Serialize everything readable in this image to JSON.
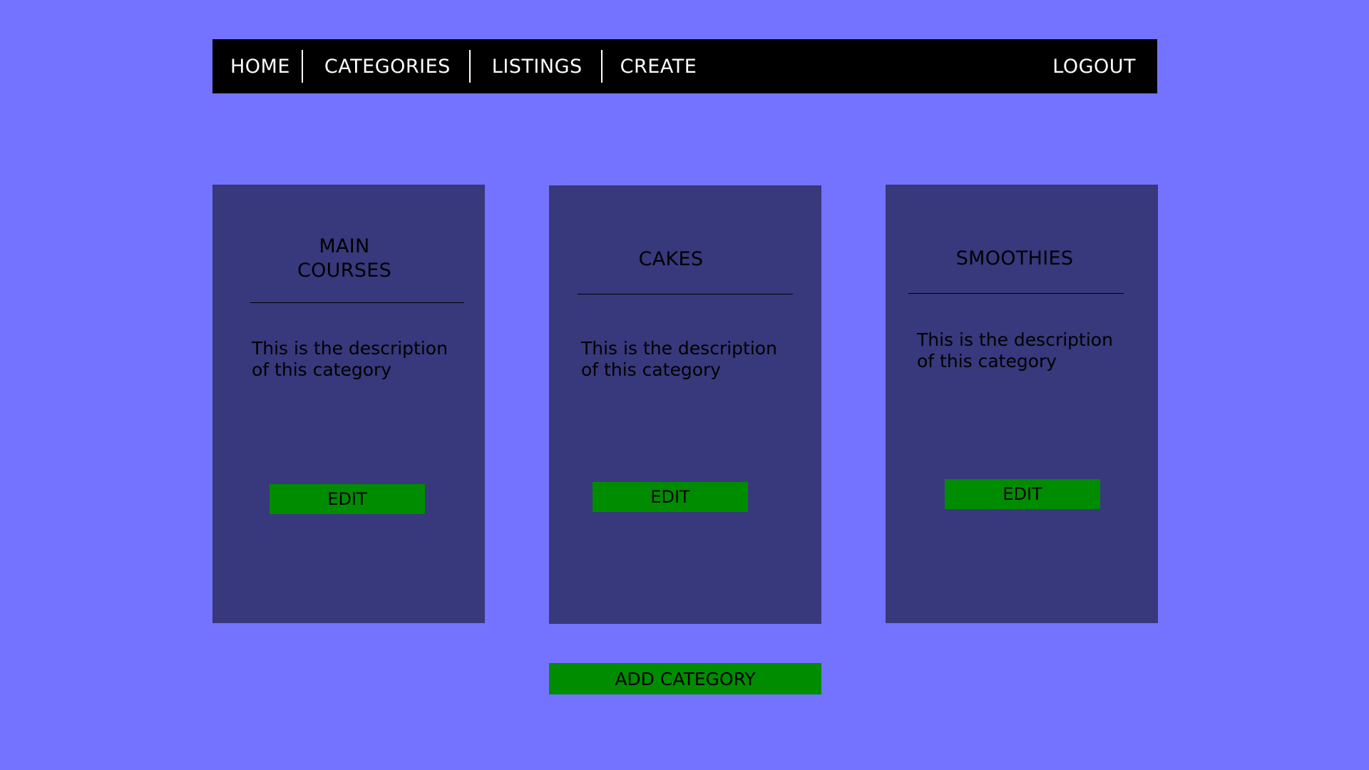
{
  "nav": {
    "home": "HOME",
    "categories": "CATEGORIES",
    "listings": "LISTINGS",
    "create": "CREATE",
    "logout": "LOGOUT"
  },
  "cards": [
    {
      "title_line1": "MAIN",
      "title_line2": "COURSES",
      "description": "This is the description of this category",
      "edit_label": "EDIT"
    },
    {
      "title": "CAKES",
      "description": "This is the description of this category",
      "edit_label": "EDIT"
    },
    {
      "title": "SMOOTHIES",
      "description": "This is the description of this category",
      "edit_label": "EDIT"
    }
  ],
  "add_category_label": "ADD CATEGORY",
  "colors": {
    "background": "#7373ff",
    "navbar": "#000000",
    "card": "#38387c",
    "button": "#008c00"
  }
}
